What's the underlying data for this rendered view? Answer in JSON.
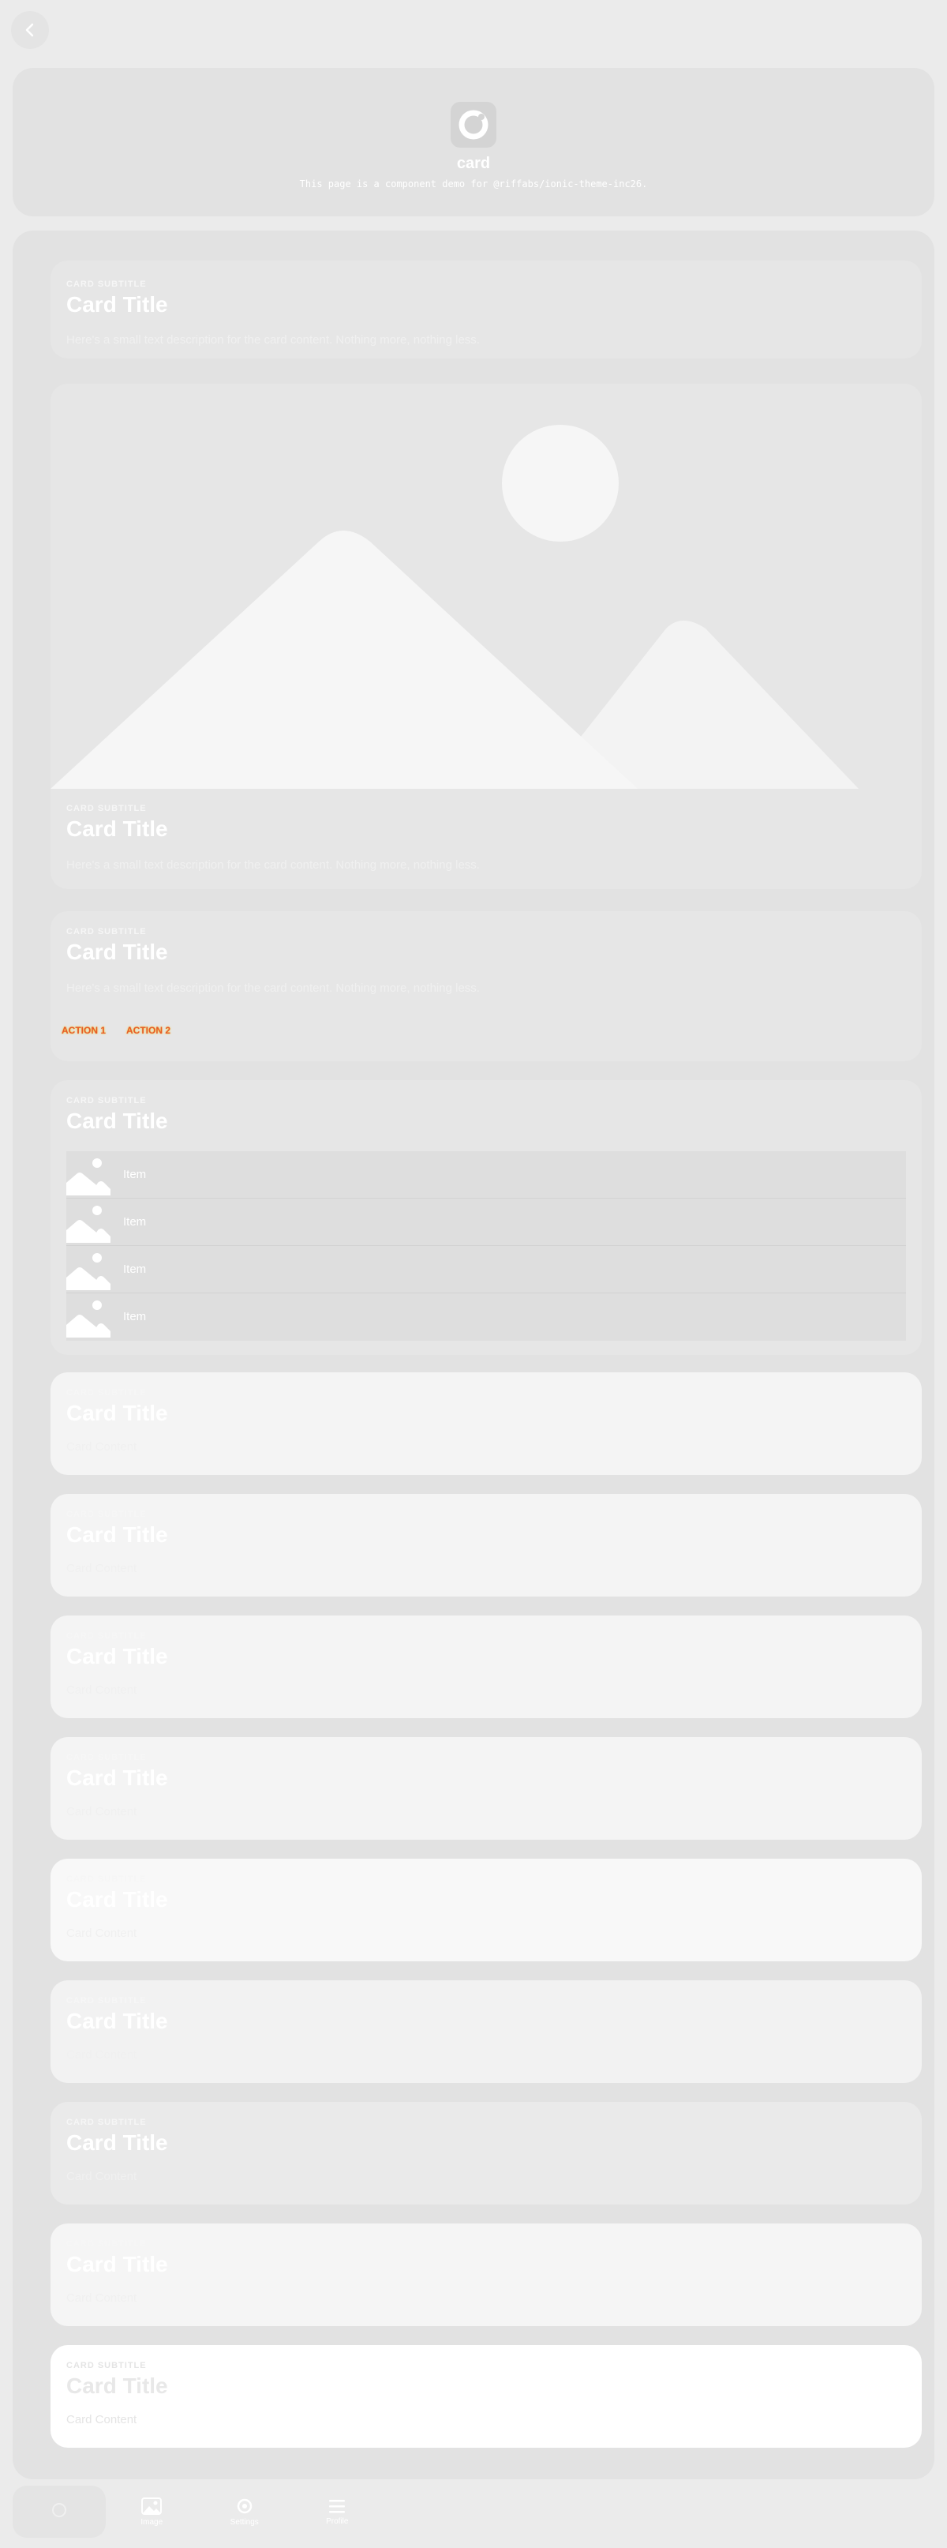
{
  "header": {
    "title": "card",
    "description": "This page is a component demo for @riffabs/ionic-theme-inc26."
  },
  "cards": {
    "card1": {
      "subtitle": "CARD SUBTITLE",
      "title": "Card Title",
      "body": "Here's a small text description for the card content. Nothing more, nothing less."
    },
    "card2": {
      "subtitle": "CARD SUBTITLE",
      "title": "Card Title",
      "body": "Here's a small text description for the card content. Nothing more, nothing less."
    },
    "card3": {
      "subtitle": "CARD SUBTITLE",
      "title": "Card Title",
      "body": "Here's a small text description for the card content. Nothing more, nothing less.",
      "actions": [
        "ACTION 1",
        "ACTION 2"
      ]
    },
    "card4": {
      "subtitle": "CARD SUBTITLE",
      "title": "Card Title",
      "items": [
        "Item",
        "Item",
        "Item",
        "Item"
      ]
    },
    "content_cards": [
      {
        "subtitle": "CARD SUBTITLE",
        "title": "Card Title",
        "content": "Card Content",
        "bg": "#f4f4f4"
      },
      {
        "subtitle": "CARD SUBTITLE",
        "title": "Card Title",
        "content": "Card Content",
        "bg": "#f4f4f4"
      },
      {
        "subtitle": "CARD SUBTITLE",
        "title": "Card Title",
        "content": "Card Content",
        "bg": "#f4f4f4"
      },
      {
        "subtitle": "CARD SUBTITLE",
        "title": "Card Title",
        "content": "Card Content",
        "bg": "#f4f4f4"
      },
      {
        "subtitle": "CARD SUBTITLE",
        "title": "Card Title",
        "content": "Card Content",
        "bg": "#f8f8f8"
      },
      {
        "subtitle": "CARD SUBTITLE",
        "title": "Card Title",
        "content": "Card Content",
        "bg": "#f2f2f2"
      },
      {
        "subtitle": "CARD SUBTITLE",
        "title": "Card Title",
        "content": "Card Content",
        "bg": "#eaeaea"
      },
      {
        "subtitle": "CARD SUBTITLE",
        "title": "Card Title",
        "content": "Card Content",
        "bg": "#f5f5f5"
      },
      {
        "subtitle": "CARD SUBTITLE",
        "title": "Card Title",
        "content": "Card Content",
        "bg": "#ffffff"
      }
    ]
  },
  "tabs": [
    {
      "label": "",
      "icon": "dots-icon"
    },
    {
      "label": "Image",
      "icon": "image-icon"
    },
    {
      "label": "Settings",
      "icon": "settings-icon"
    },
    {
      "label": "Profile",
      "icon": "list-icon"
    }
  ],
  "colors": {
    "page_bg": "#ebebeb",
    "panel_bg": "#e2e2e2",
    "card_bg": "#e6e6e6",
    "action_color": "#e85a2a"
  }
}
